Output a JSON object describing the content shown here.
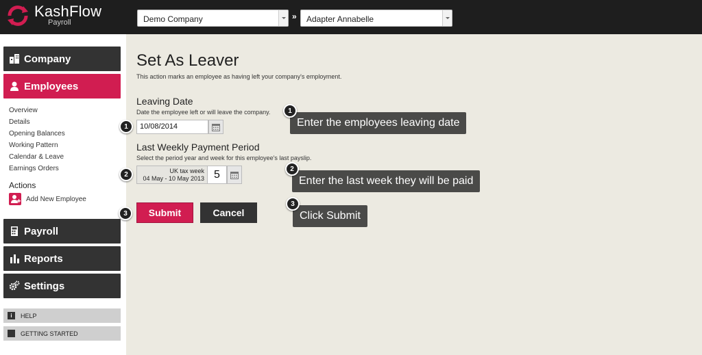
{
  "header": {
    "logo_name": "KashFlow",
    "logo_sub": "Payroll",
    "company_select": "Demo Company",
    "separator": "»",
    "employee_select": "Adapter Annabelle"
  },
  "sidebar": {
    "company": "Company",
    "employees": "Employees",
    "subnav": [
      "Overview",
      "Details",
      "Opening Balances",
      "Working Pattern",
      "Calendar & Leave",
      "Earnings Orders"
    ],
    "actions_title": "Actions",
    "add_new_employee": "Add New Employee",
    "payroll": "Payroll",
    "reports": "Reports",
    "settings": "Settings",
    "help": "HELP",
    "help_icon": "i",
    "getting_started": "GETTING STARTED"
  },
  "main": {
    "title": "Set As Leaver",
    "subtitle": "This action marks an employee as having left your company's employment.",
    "leaving_date": {
      "title": "Leaving Date",
      "desc": "Date the employee left or will leave the company.",
      "value": "10/08/2014"
    },
    "last_period": {
      "title": "Last Weekly Payment Period",
      "desc": "Select the period year and week for this employee's last payslip.",
      "week_label": "UK tax week",
      "week_range": "04 May - 10 May 2013",
      "week_number": "5"
    },
    "submit": "Submit",
    "cancel": "Cancel"
  },
  "annotations": [
    {
      "num": "1",
      "tip": "Enter the employees leaving date"
    },
    {
      "num": "2",
      "tip": "Enter the last week they will be paid"
    },
    {
      "num": "3",
      "tip": "Click Submit"
    }
  ],
  "colors": {
    "accent": "#d11d51",
    "dark": "#333333",
    "background": "#eceae1"
  }
}
